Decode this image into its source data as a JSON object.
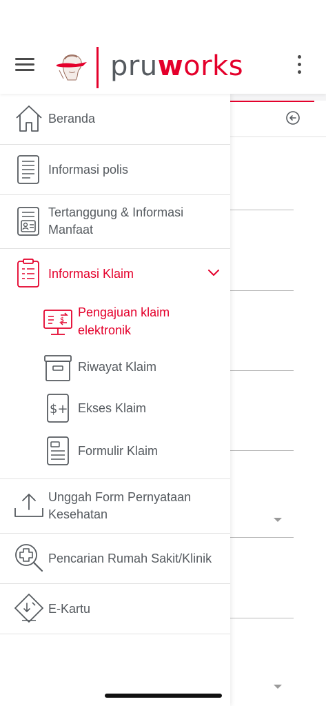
{
  "header": {
    "logo": {
      "pru": "pru",
      "w": "w",
      "orks": "orks"
    },
    "menu_icon": "hamburger-icon",
    "more_icon": "kebab-icon"
  },
  "colors": {
    "brand_red": "#e4002b",
    "text_gray": "#555a5f",
    "divider": "#e2e2e2"
  },
  "drawer": {
    "items": [
      {
        "label": "Beranda",
        "icon": "home-icon"
      },
      {
        "label": "Informasi polis",
        "icon": "document-icon"
      },
      {
        "label": "Tertanggung & Informasi Manfaat",
        "label_line1": "Tertanggung & Informasi",
        "label_line2": "Manfaat",
        "icon": "id-card-icon"
      },
      {
        "label": "Informasi Klaim",
        "icon": "clipboard-icon",
        "expanded": true,
        "active": true
      }
    ],
    "sub_items": [
      {
        "label": "Pengajuan klaim elektronik",
        "label_line1": "Pengajuan klaim",
        "label_line2": "elektronik",
        "icon": "monitor-dollar-icon",
        "active": true
      },
      {
        "label": "Riwayat Klaim",
        "icon": "archive-box-icon"
      },
      {
        "label": "Ekses Klaim",
        "icon": "dollar-plus-icon"
      },
      {
        "label": "Formulir Klaim",
        "icon": "form-icon"
      }
    ],
    "bottom_items": [
      {
        "label": "Unggah Form Pernyataan Kesehatan",
        "label_line1": "Unggah Form Pernyataan",
        "label_line2": "Kesehatan",
        "icon": "upload-icon"
      },
      {
        "label": "Pencarian Rumah Sakit/Klinik",
        "icon": "hospital-search-icon"
      },
      {
        "label": "E-Kartu",
        "icon": "e-card-icon"
      }
    ]
  }
}
